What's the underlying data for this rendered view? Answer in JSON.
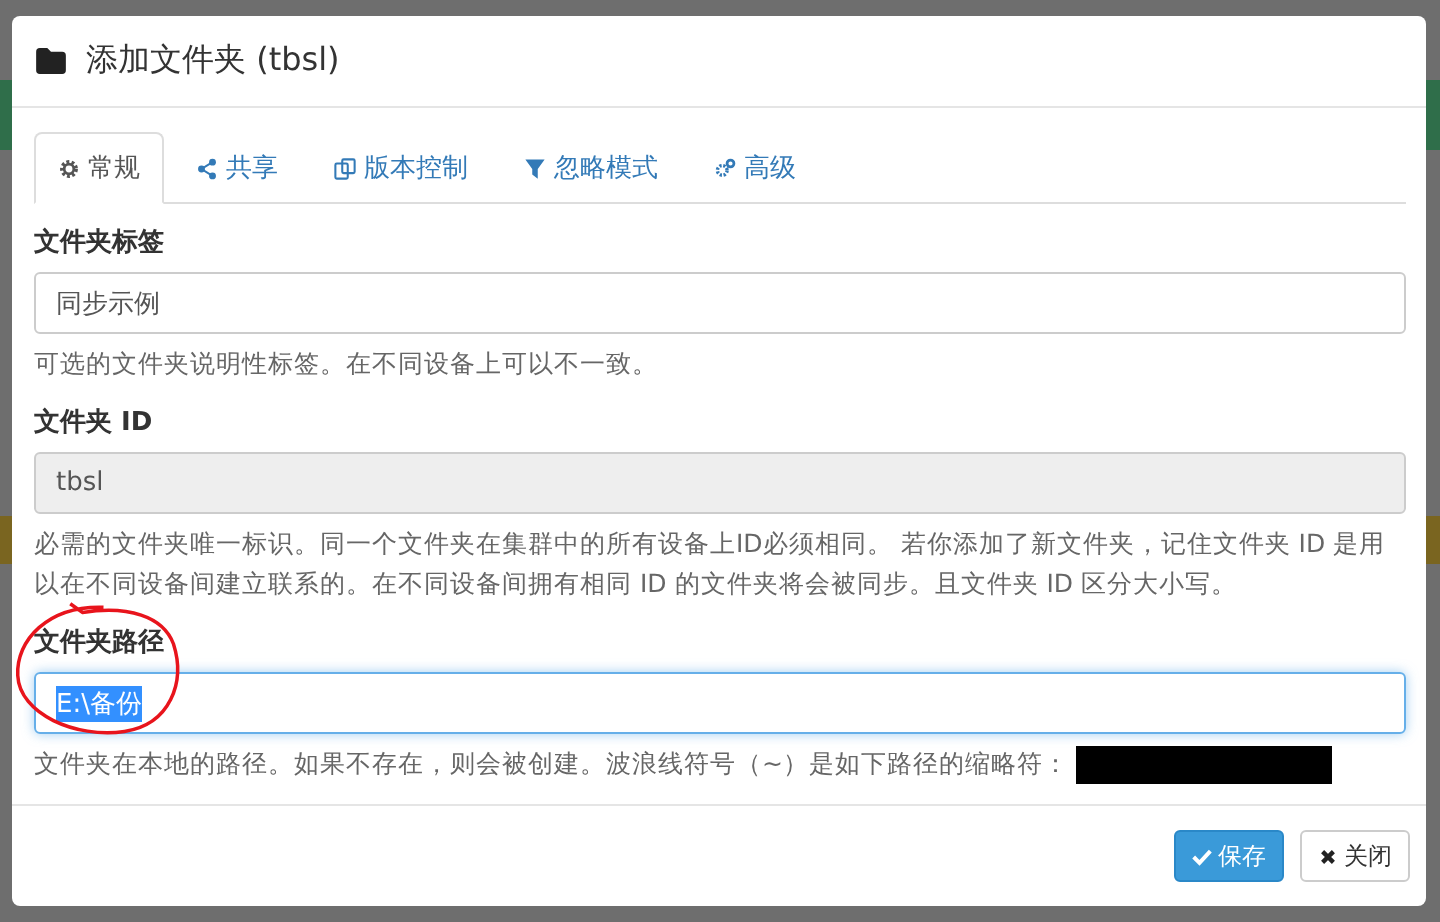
{
  "dialog": {
    "title": "添加文件夹 (tbsl)"
  },
  "tabs": [
    {
      "label": "常规",
      "selected": true
    },
    {
      "label": "共享",
      "selected": false
    },
    {
      "label": "版本控制",
      "selected": false
    },
    {
      "label": "忽略模式",
      "selected": false
    },
    {
      "label": "高级",
      "selected": false
    }
  ],
  "fields": [
    {
      "label": "文件夹标签",
      "value": "同步示例",
      "disabled": false,
      "focused": false,
      "selected_text": false,
      "help": "可选的文件夹说明性标签。在不同设备上可以不一致。",
      "redacted": false
    },
    {
      "label": "文件夹 ID",
      "value": "tbsl",
      "disabled": true,
      "focused": false,
      "selected_text": false,
      "help": "必需的文件夹唯一标识。同一个文件夹在集群中的所有设备上ID必须相同。 若你添加了新文件夹，记住文件夹 ID 是用以在不同设备间建立联系的。在不同设备间拥有相同 ID 的文件夹将会被同步。且文件夹 ID 区分大小写。",
      "redacted": false
    },
    {
      "label": "文件夹路径",
      "value": "E:\\备份",
      "disabled": false,
      "focused": true,
      "selected_text": true,
      "help": "文件夹在本地的路径。如果不存在，则会被创建。波浪线符号（~）是如下路径的缩略符：",
      "redacted": true
    }
  ],
  "buttons": [
    {
      "label": "保存",
      "kind": "primary"
    },
    {
      "label": "关闭",
      "kind": "default"
    }
  ]
}
